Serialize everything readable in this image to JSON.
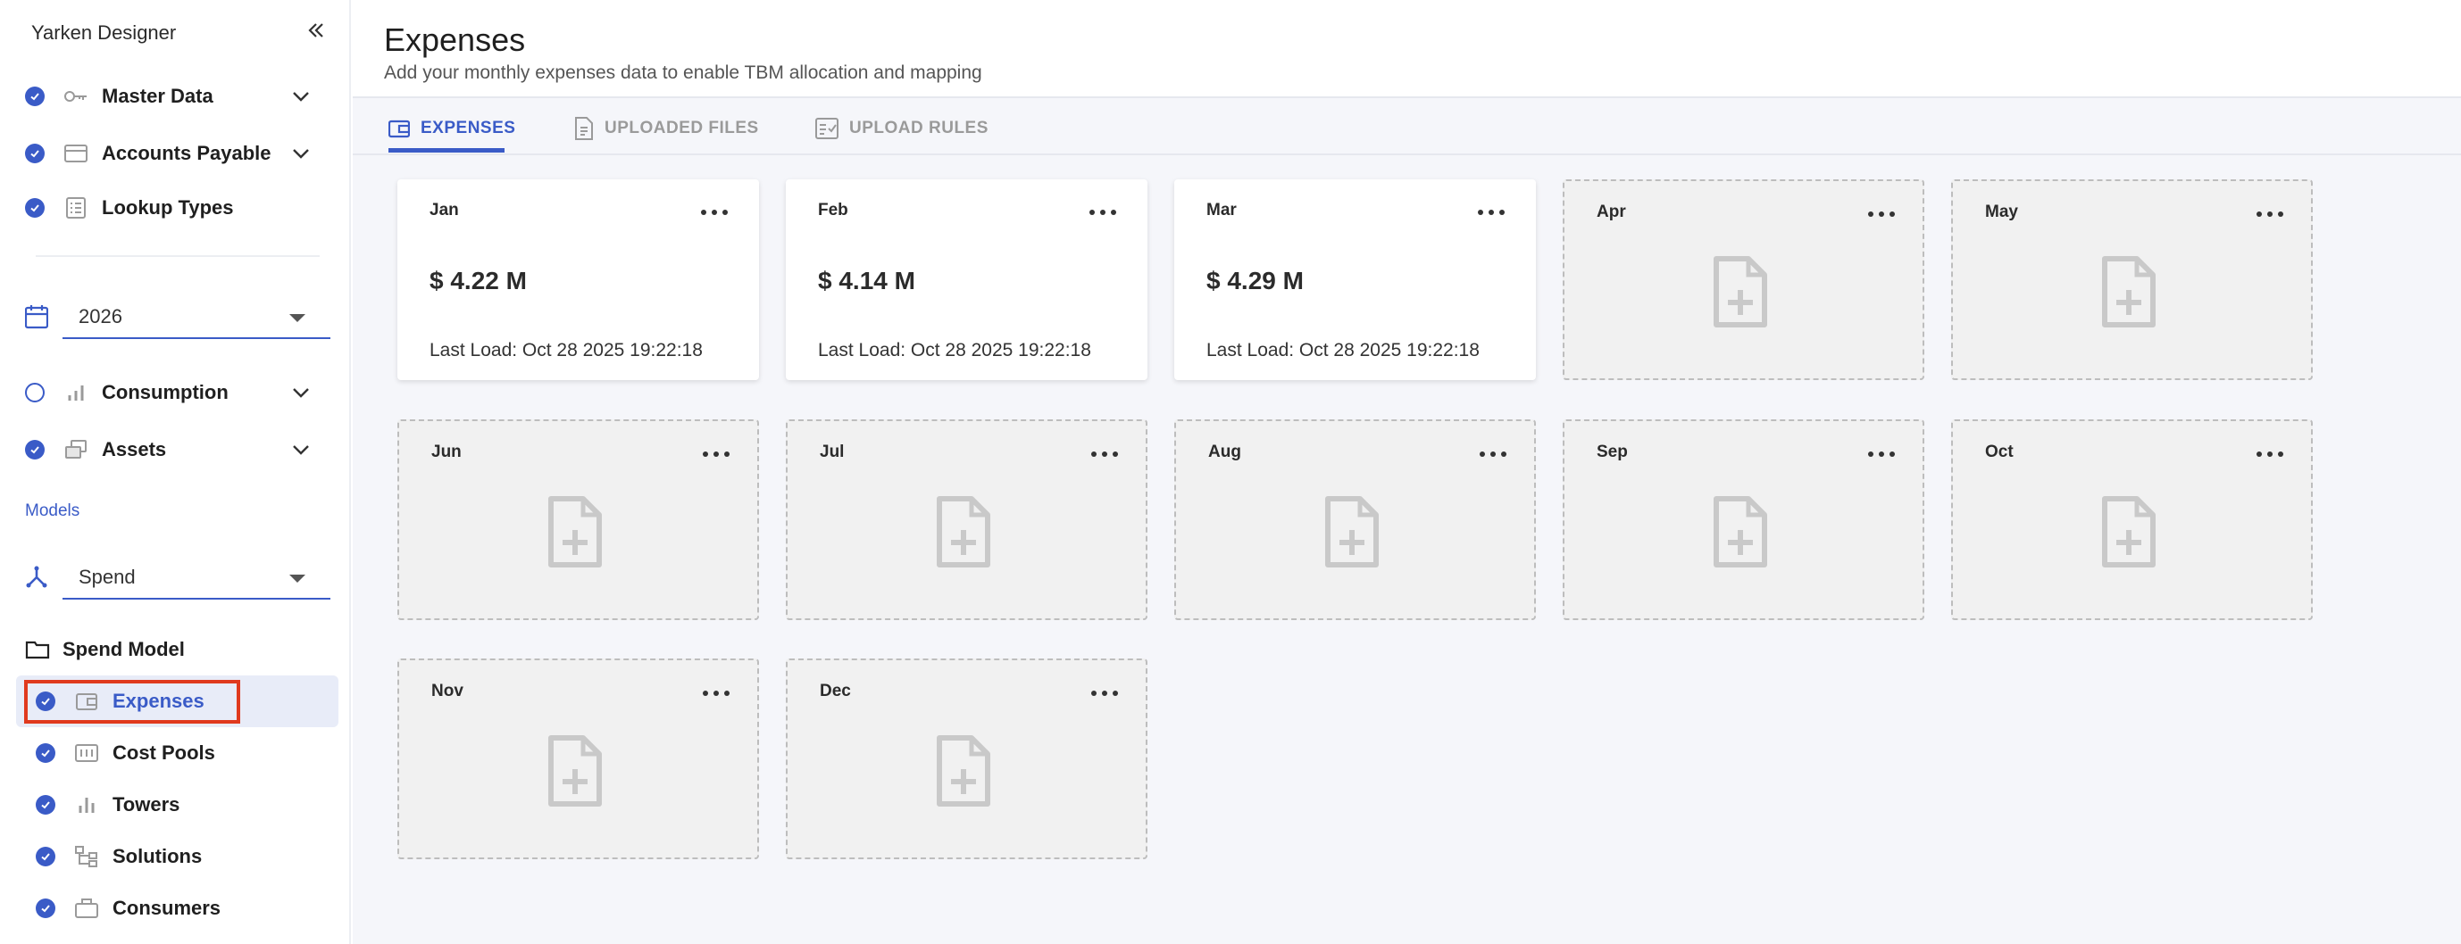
{
  "sidebar": {
    "app_title": "Yarken Designer",
    "items": [
      {
        "label": "Master Data",
        "status": "done",
        "icon": "key-icon"
      },
      {
        "label": "Accounts Payable",
        "status": "done",
        "icon": "credit-card-icon"
      },
      {
        "label": "Lookup Types",
        "status": "done",
        "icon": "list-icon"
      }
    ],
    "year_select": {
      "value": "2026",
      "icon": "calendar-icon"
    },
    "items2": [
      {
        "label": "Consumption",
        "status": "pending",
        "icon": "bar-chart-icon"
      },
      {
        "label": "Assets",
        "status": "done",
        "icon": "stack-icon"
      }
    ],
    "models_label": "Models",
    "model_select": {
      "value": "Spend",
      "icon": "network-icon"
    },
    "folder": {
      "label": "Spend Model",
      "icon": "folder-icon"
    },
    "sub_items": [
      {
        "label": "Expenses",
        "icon": "wallet-icon",
        "active": true
      },
      {
        "label": "Cost Pools",
        "icon": "pool-icon"
      },
      {
        "label": "Towers",
        "icon": "tower-icon"
      },
      {
        "label": "Solutions",
        "icon": "hierarchy-icon"
      },
      {
        "label": "Consumers",
        "icon": "briefcase-icon"
      }
    ]
  },
  "header": {
    "title": "Expenses",
    "subtitle": "Add your monthly expenses data to enable TBM allocation and mapping"
  },
  "tabs": [
    {
      "label": "EXPENSES",
      "active": true
    },
    {
      "label": "UPLOADED FILES",
      "active": false
    },
    {
      "label": "UPLOAD RULES",
      "active": false
    }
  ],
  "months": [
    {
      "month": "Jan",
      "amount": "$ 4.22 M",
      "last_load": "Last Load: Oct 28 2025 19:22:18"
    },
    {
      "month": "Feb",
      "amount": "$ 4.14 M",
      "last_load": "Last Load: Oct 28 2025 19:22:18"
    },
    {
      "month": "Mar",
      "amount": "$ 4.29 M",
      "last_load": "Last Load: Oct 28 2025 19:22:18"
    },
    {
      "month": "Apr"
    },
    {
      "month": "May"
    },
    {
      "month": "Jun"
    },
    {
      "month": "Jul"
    },
    {
      "month": "Aug"
    },
    {
      "month": "Sep"
    },
    {
      "month": "Oct"
    },
    {
      "month": "Nov"
    },
    {
      "month": "Dec"
    }
  ],
  "colors": {
    "accent": "#3a5bc7",
    "highlight_outline": "#e03a1e",
    "empty_card": "#f1f1f1"
  }
}
